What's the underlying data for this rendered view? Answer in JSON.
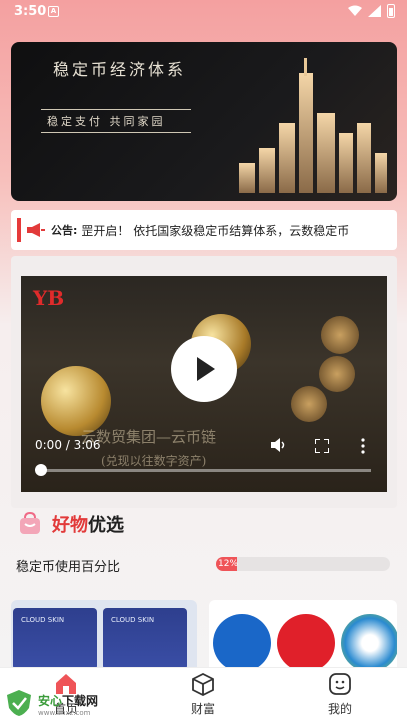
{
  "status_bar": {
    "time": "3:50",
    "badge": "A"
  },
  "banner": {
    "title": "稳定币经济体系",
    "subtitle": "稳定支付  共同家园"
  },
  "notice": {
    "label": "公告:",
    "text": "罡开启！ 依托国家级稳定币结算体系，云数稳定币"
  },
  "video": {
    "logo": "YB",
    "time": "0:00 / 3:06",
    "caption": "云数贸集团—云币链",
    "caption2": "(兑现以往数字资产)",
    "progress": 0
  },
  "section": {
    "title_a": "好物",
    "title_b": "优选"
  },
  "percent": {
    "label": "稳定币使用百分比",
    "value_text": "12%",
    "value": 0.12
  },
  "products": {
    "left_brand": "CLOUD SKIN"
  },
  "nav": {
    "items": [
      {
        "label": "首页",
        "icon": "home-icon"
      },
      {
        "label": "财富",
        "icon": "box-icon"
      },
      {
        "label": "我的",
        "icon": "smile-icon"
      }
    ]
  },
  "watermark": {
    "title_a": "安心",
    "title_b": "下载网",
    "url": "www.anxz.com"
  },
  "colors": {
    "accent": "#e23a3a",
    "progress": "#ef5458"
  }
}
